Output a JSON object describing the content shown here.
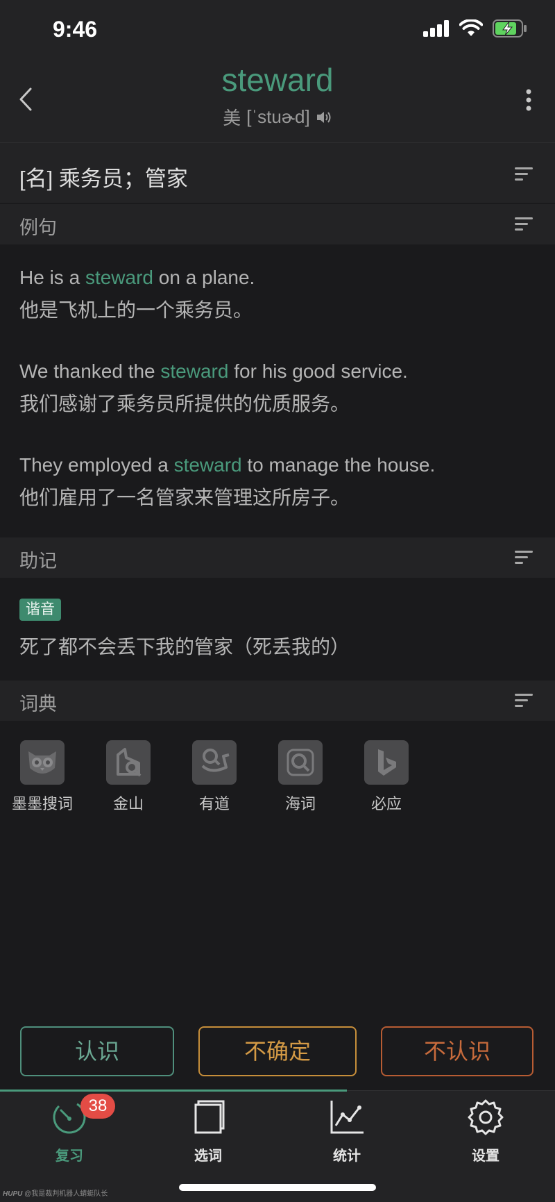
{
  "status_bar": {
    "time": "9:46"
  },
  "header": {
    "word": "steward",
    "phonetic_region": "美",
    "phonetic": "[ˈstuɚd]"
  },
  "definition": "[名] 乘务员；管家",
  "sections": {
    "examples_title": "例句",
    "mnemonic_title": "助记",
    "dict_title": "词典"
  },
  "examples": [
    {
      "en_before": "He is a ",
      "en_highlight": "steward",
      "en_after": " on a plane.",
      "cn": "他是飞机上的一个乘务员。"
    },
    {
      "en_before": "We thanked the ",
      "en_highlight": "steward",
      "en_after": " for his good service.",
      "cn": "我们感谢了乘务员所提供的优质服务。"
    },
    {
      "en_before": "They employed a ",
      "en_highlight": "steward",
      "en_after": " to manage the house.",
      "cn": "他们雇用了一名管家来管理这所房子。"
    }
  ],
  "mnemonic": {
    "tag": "谐音",
    "text": "死了都不会丢下我的管家（死丢我的）"
  },
  "dictionaries": [
    {
      "label": "墨墨搜词",
      "icon": "owl-icon"
    },
    {
      "label": "金山",
      "icon": "kingsoft-icon"
    },
    {
      "label": "有道",
      "icon": "youdao-icon"
    },
    {
      "label": "海词",
      "icon": "dict-cn-icon"
    },
    {
      "label": "必应",
      "icon": "bing-icon"
    }
  ],
  "actions": {
    "know": "认识",
    "unsure": "不确定",
    "unknown": "不认识"
  },
  "tabs": [
    {
      "label": "复习",
      "badge": "38"
    },
    {
      "label": "选词"
    },
    {
      "label": "统计"
    },
    {
      "label": "设置"
    }
  ],
  "watermark": {
    "brand": "HUPU",
    "text": "@我是裁判机器人蜻蜓队长"
  },
  "colors": {
    "accent": "#4a9a7c",
    "unsure": "#c68e3a",
    "unknown": "#b75c33",
    "badge": "#e34c45"
  }
}
